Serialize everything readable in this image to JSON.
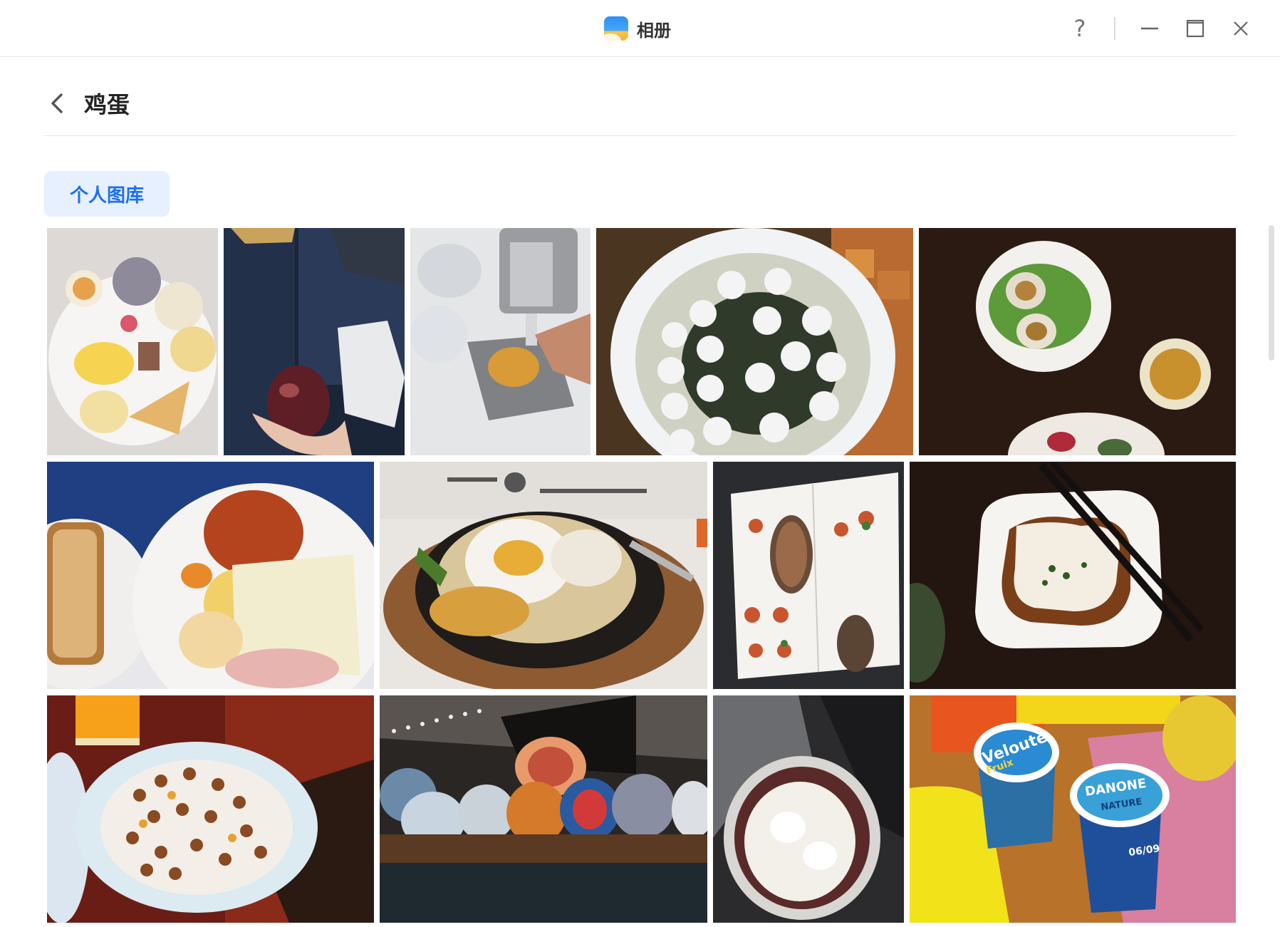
{
  "window": {
    "title": "相册",
    "icon": "photos-app-icon",
    "help_label": "?"
  },
  "header": {
    "back_icon": "chevron-left-icon",
    "title": "鸡蛋"
  },
  "tabs": [
    {
      "label": "个人图库",
      "selected": true
    }
  ],
  "photos": [
    {
      "subject": "breakfast-plate-eggs-buns"
    },
    {
      "subject": "hand-holding-tea-egg-on-train"
    },
    {
      "subject": "coffee-machine-dispensing"
    },
    {
      "subject": "fish-ball-soup-bowl"
    },
    {
      "subject": "salted-duck-eggs-on-lettuce"
    },
    {
      "subject": "english-breakfast-beans-cheese"
    },
    {
      "subject": "fried-egg-skillet"
    },
    {
      "subject": "restaurant-menu"
    },
    {
      "subject": "steamed-egg-tofu-plate"
    },
    {
      "subject": "cereal-bowl-with-milk"
    },
    {
      "subject": "mosaic-glass-lanterns"
    },
    {
      "subject": "whipped-cream-cup"
    },
    {
      "subject": "yogurt-cups-on-tray"
    }
  ],
  "yogurt_labels": {
    "left_brand": "Velouté",
    "left_flavor": "Fruix",
    "right_brand": "DANONE",
    "right_variant": "NATURE",
    "right_date": "06/09"
  },
  "colors": {
    "accent": "#1e6ff0",
    "tab_bg": "#e6f0ff"
  }
}
